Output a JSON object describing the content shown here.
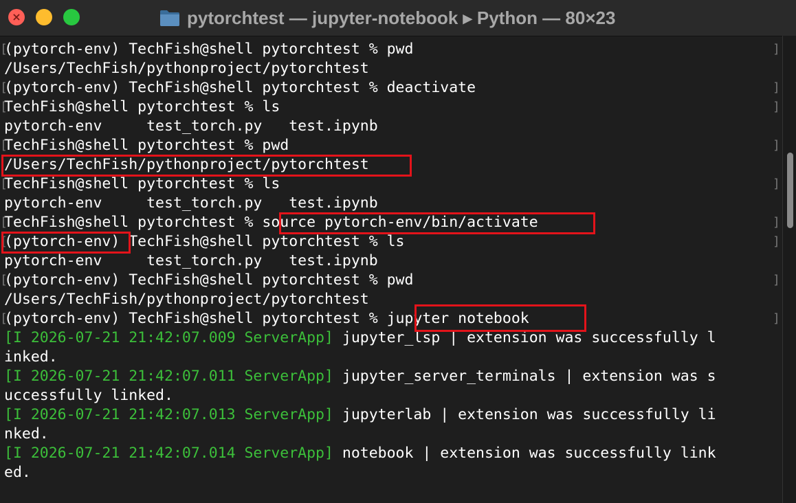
{
  "window": {
    "title": "pytorchtest — jupyter-notebook ▸ Python — 80×23"
  },
  "terminal": {
    "lines": [
      {
        "text": "(pytorch-env) TechFish@shell pytorchtest % pwd"
      },
      {
        "text": "/Users/TechFish/pythonproject/pytorchtest"
      },
      {
        "text": "(pytorch-env) TechFish@shell pytorchtest % deactivate"
      },
      {
        "text": "TechFish@shell pytorchtest % ls"
      },
      {
        "text": "pytorch-env     test_torch.py   test.ipynb"
      },
      {
        "text": "TechFish@shell pytorchtest % pwd"
      },
      {
        "text": "/Users/TechFish/pythonproject/pytorchtest"
      },
      {
        "text": "TechFish@shell pytorchtest % ls"
      },
      {
        "text": "pytorch-env     test_torch.py   test.ipynb"
      },
      {
        "text": "TechFish@shell pytorchtest % source pytorch-env/bin/activate"
      },
      {
        "text": "(pytorch-env) TechFish@shell pytorchtest % ls"
      },
      {
        "text": "pytorch-env     test_torch.py   test.ipynb"
      },
      {
        "text": "(pytorch-env) TechFish@shell pytorchtest % pwd"
      },
      {
        "text": "/Users/TechFish/pythonproject/pytorchtest"
      },
      {
        "text": "(pytorch-env) TechFish@shell pytorchtest % jupyter notebook"
      },
      {
        "log": "[I 2026-07-21 21:42:07.009 ServerApp]",
        "text": " jupyter_lsp | extension was successfully l"
      },
      {
        "text": "inked."
      },
      {
        "log": "[I 2026-07-21 21:42:07.011 ServerApp]",
        "text": " jupyter_server_terminals | extension was s"
      },
      {
        "text": "uccessfully linked."
      },
      {
        "log": "[I 2026-07-21 21:42:07.013 ServerApp]",
        "text": " jupyterlab | extension was successfully li"
      },
      {
        "text": "nked."
      },
      {
        "log": "[I 2026-07-21 21:42:07.014 ServerApp]",
        "text": " notebook | extension was successfully link"
      },
      {
        "text": "ed."
      }
    ]
  },
  "colors": {
    "background": "#1e1e1e",
    "text": "#ffffff",
    "log_prefix": "#3cbf3a",
    "highlight": "#e3131a"
  }
}
